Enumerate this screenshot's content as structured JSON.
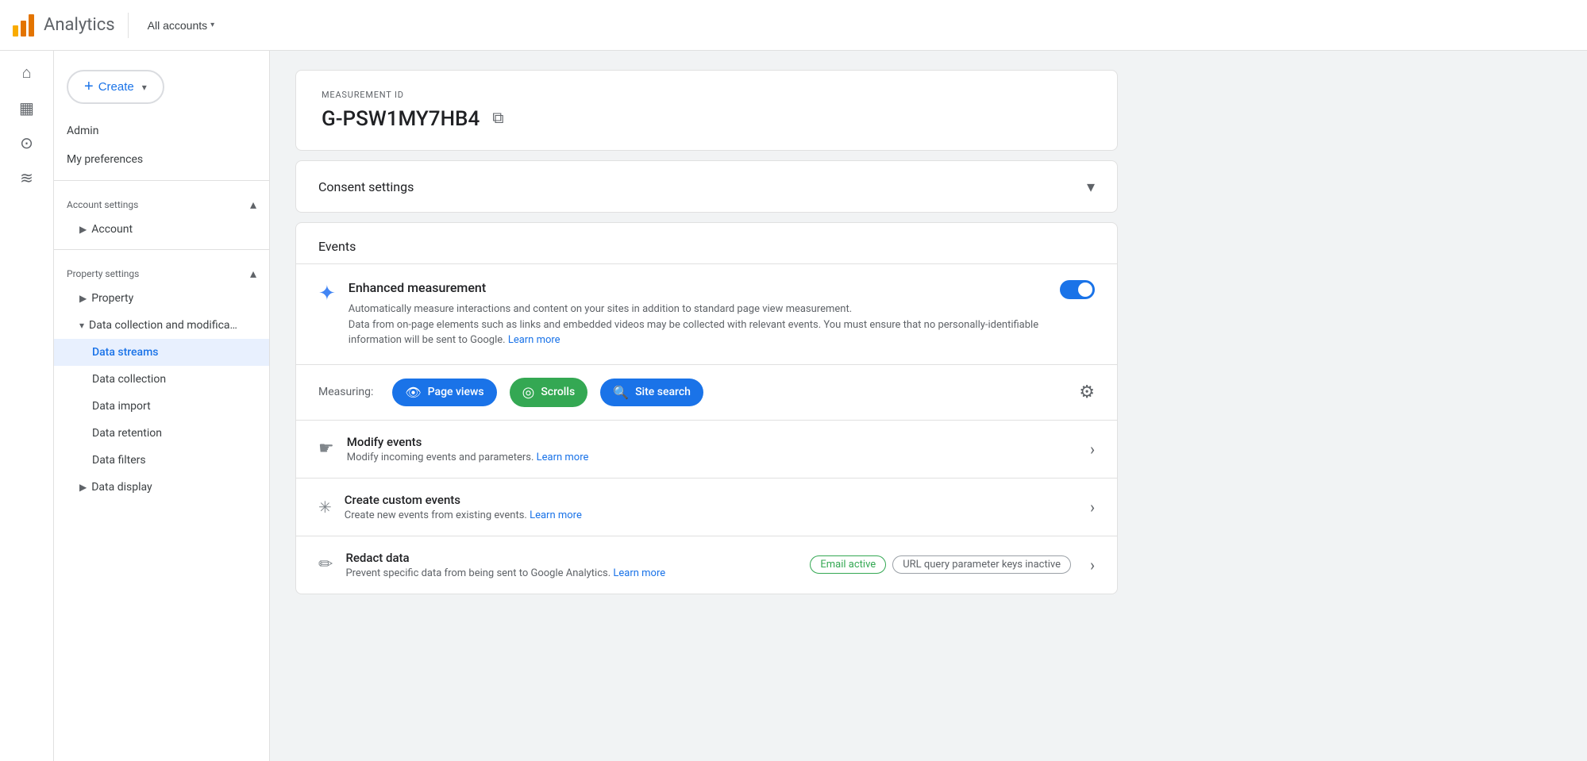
{
  "topbar": {
    "title": "Analytics",
    "all_accounts": "All accounts"
  },
  "sidebar": {
    "create_btn": "Create",
    "nav_items": [
      {
        "id": "admin",
        "label": "Admin"
      },
      {
        "id": "my_preferences",
        "label": "My preferences"
      }
    ],
    "account_settings": {
      "header": "Account settings",
      "items": [
        {
          "id": "account",
          "label": "Account",
          "has_expand": true
        }
      ]
    },
    "property_settings": {
      "header": "Property settings",
      "items": [
        {
          "id": "property",
          "label": "Property",
          "has_expand": true
        },
        {
          "id": "data_collection",
          "label": "Data collection and modifica…",
          "has_expand": true,
          "expanded": true
        },
        {
          "id": "data_streams",
          "label": "Data streams",
          "active": true
        },
        {
          "id": "data_collection_sub",
          "label": "Data collection"
        },
        {
          "id": "data_import",
          "label": "Data import"
        },
        {
          "id": "data_retention",
          "label": "Data retention"
        },
        {
          "id": "data_filters",
          "label": "Data filters"
        },
        {
          "id": "data_display",
          "label": "Data display",
          "has_expand": true
        }
      ]
    }
  },
  "main": {
    "measurement_id": {
      "label": "MEASUREMENT ID",
      "value": "G-PSW1MY7HB4",
      "copy_icon": "⧉"
    },
    "consent_settings": {
      "title": "Consent settings"
    },
    "events": {
      "header": "Events",
      "enhanced_measurement": {
        "title": "Enhanced measurement",
        "icon": "✦",
        "description": "Automatically measure interactions and content on your sites in addition to standard page view measurement.",
        "description2": "Data from on-page elements such as links and embedded videos may be collected with relevant events. You must ensure that no personally-identifiable information will be sent to Google.",
        "learn_more": "Learn more",
        "toggle_on": true
      },
      "measuring": {
        "label": "Measuring:",
        "chips": [
          {
            "id": "page_views",
            "label": "Page views",
            "icon": "👁",
            "style": "blue"
          },
          {
            "id": "scrolls",
            "label": "Scrolls",
            "icon": "◎",
            "style": "green"
          },
          {
            "id": "site_search",
            "label": "Site search",
            "icon": "🔍",
            "style": "blue"
          }
        ]
      },
      "rows": [
        {
          "id": "modify_events",
          "icon": "✋",
          "title": "Modify events",
          "description": "Modify incoming events and parameters.",
          "learn_more": "Learn more",
          "has_chevron": true
        },
        {
          "id": "create_custom_events",
          "icon": "✳",
          "title": "Create custom events",
          "description": "Create new events from existing events.",
          "learn_more": "Learn more",
          "has_chevron": true
        },
        {
          "id": "redact_data",
          "icon": "✏",
          "title": "Redact data",
          "description": "Prevent specific data from being sent to Google Analytics.",
          "learn_more": "Learn more",
          "badge_active": "Email active",
          "badge_inactive": "URL query parameter keys inactive",
          "has_chevron": true
        }
      ]
    }
  },
  "icons": {
    "home": "⌂",
    "chart": "▦",
    "search": "⊙",
    "signal": "≋",
    "gear": "⚙",
    "chevron_down": "▾",
    "chevron_right": "›",
    "copy": "⧉",
    "plus": "+",
    "sparkle": "✦"
  }
}
